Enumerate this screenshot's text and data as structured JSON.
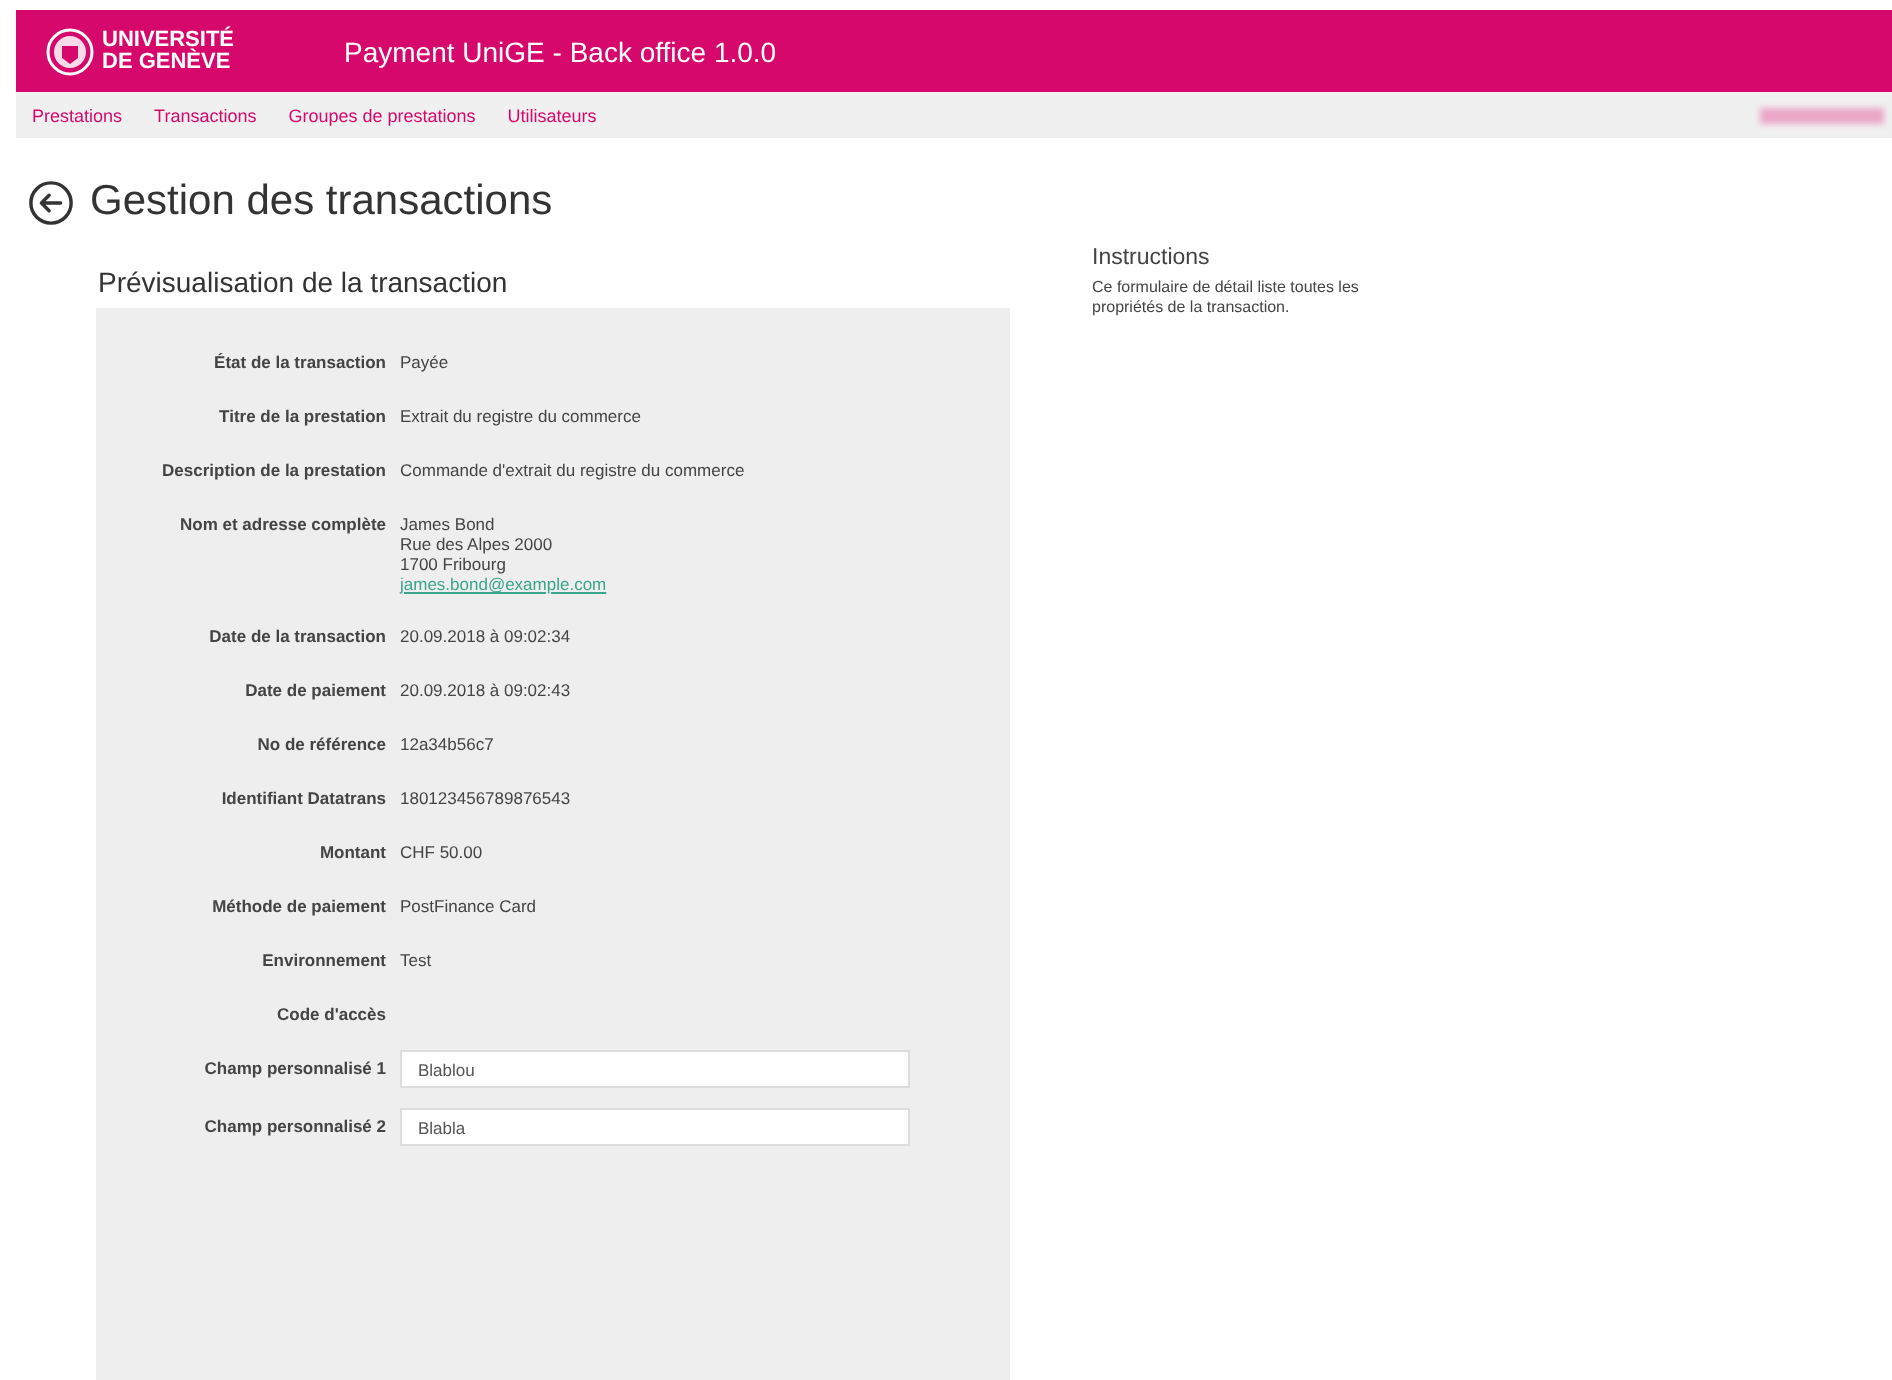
{
  "header": {
    "logo_lines": [
      "UNIVERSITÉ",
      "DE GENÈVE"
    ],
    "title": "Payment UniGE - Back office 1.0.0"
  },
  "nav": {
    "items": [
      {
        "label": "Prestations"
      },
      {
        "label": "Transactions"
      },
      {
        "label": "Groupes de prestations"
      },
      {
        "label": "Utilisateurs"
      }
    ]
  },
  "page_title": "Gestion des transactions",
  "section_title": "Prévisualisation de la transaction",
  "fields": [
    {
      "kind": "text",
      "label": "État de la transaction",
      "value": "Payée"
    },
    {
      "kind": "text",
      "label": "Titre de la prestation",
      "value": "Extrait du registre du commerce"
    },
    {
      "kind": "text",
      "label": "Description de la prestation",
      "value": "Commande d'extrait du registre du commerce"
    },
    {
      "kind": "address",
      "label": "Nom et adresse complète",
      "lines": [
        "James Bond",
        "Rue des Alpes 2000",
        "1700 Fribourg"
      ],
      "email": "james.bond@example.com"
    },
    {
      "kind": "text",
      "label": "Date de la transaction",
      "value": "20.09.2018 à 09:02:34"
    },
    {
      "kind": "text",
      "label": "Date de paiement",
      "value": "20.09.2018 à 09:02:43"
    },
    {
      "kind": "text",
      "label": "No de référence",
      "value": "12a34b56c7"
    },
    {
      "kind": "text",
      "label": "Identifiant Datatrans",
      "value": "180123456789876543"
    },
    {
      "kind": "text",
      "label": "Montant",
      "value": "CHF 50.00"
    },
    {
      "kind": "text",
      "label": "Méthode de paiement",
      "value": "PostFinance Card"
    },
    {
      "kind": "text",
      "label": "Environnement",
      "value": "Test"
    },
    {
      "kind": "text",
      "label": "Code d'accès"
    },
    {
      "kind": "input",
      "label": "Champ personnalisé 1",
      "value": "Blablou"
    },
    {
      "kind": "input",
      "label": "Champ personnalisé 2",
      "value": "Blabla"
    }
  ],
  "instructions": {
    "title": "Instructions",
    "text": "Ce formulaire de détail liste toutes les propriétés de la transaction."
  }
}
